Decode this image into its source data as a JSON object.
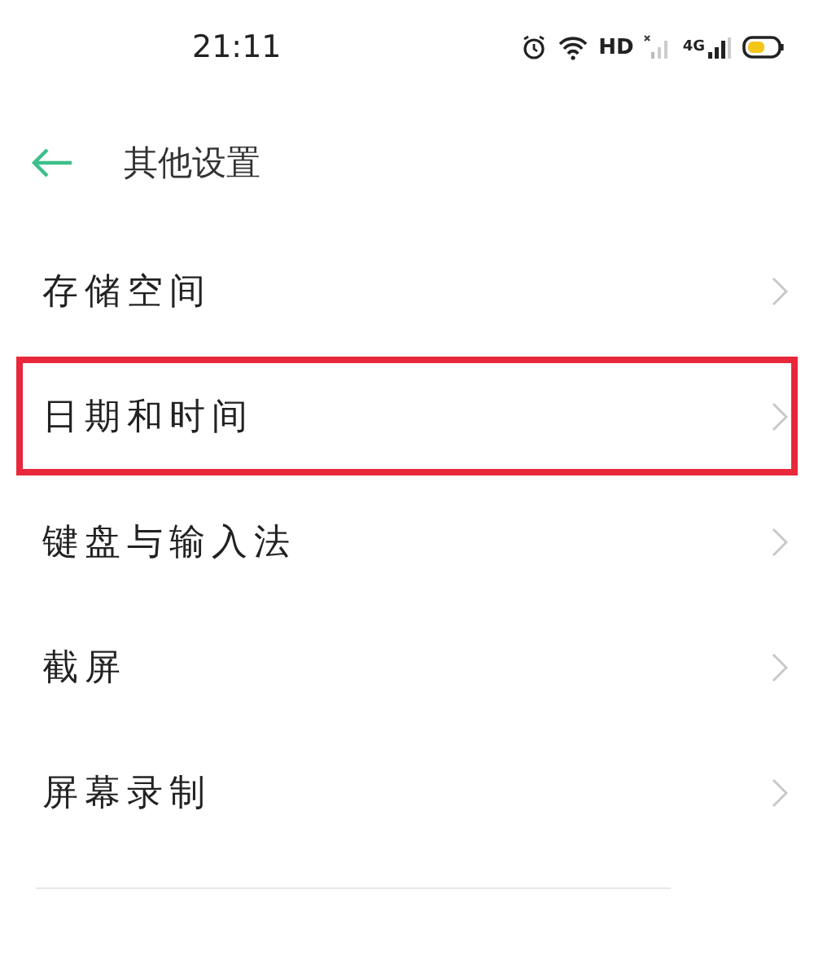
{
  "status_bar": {
    "time": "21:11",
    "hd_label": "HD",
    "network_label": "4G"
  },
  "header": {
    "title": "其他设置"
  },
  "items": [
    {
      "label": "存储空间",
      "highlighted": false
    },
    {
      "label": "日期和时间",
      "highlighted": true
    },
    {
      "label": "键盘与输入法",
      "highlighted": false
    },
    {
      "label": "截屏",
      "highlighted": false
    },
    {
      "label": "屏幕录制",
      "highlighted": false
    }
  ]
}
